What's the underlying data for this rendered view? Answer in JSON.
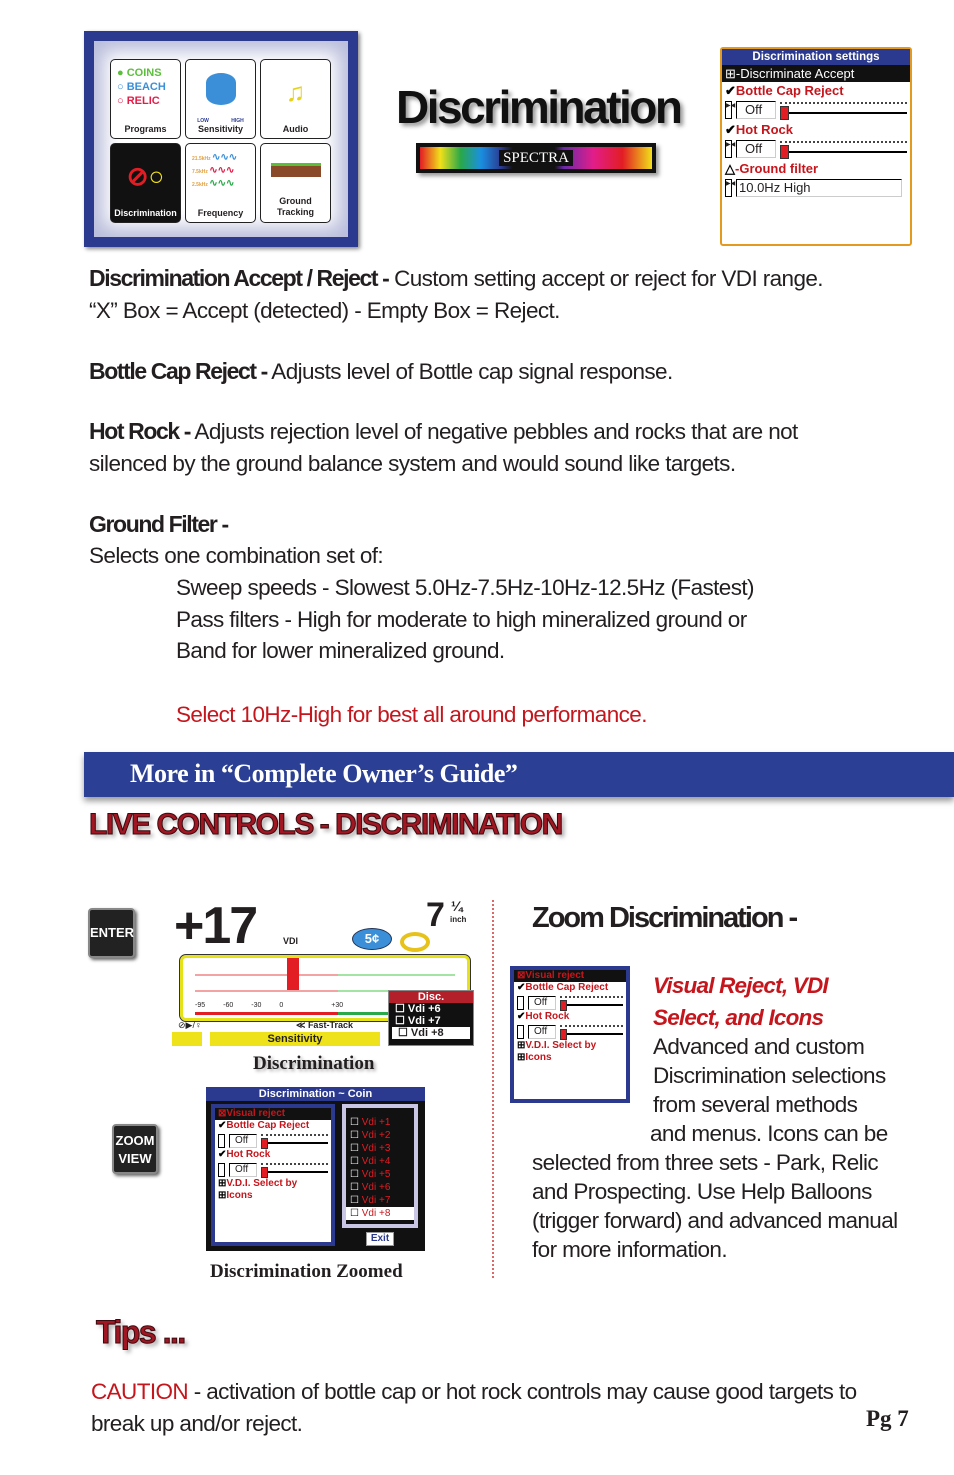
{
  "menu": {
    "programs": {
      "options": [
        "COINS",
        "BEACH",
        "RELIC"
      ],
      "label": "Programs"
    },
    "tiles": [
      "Sensitivity",
      "Audio",
      "Discrimination",
      "Frequency",
      "Ground Tracking"
    ],
    "sensitivity_scale": [
      "LOW",
      "HIGH"
    ],
    "frequencies": [
      "21.5kHz",
      "7.5kHz",
      "2.5kHz"
    ]
  },
  "page_title": "Discrimination",
  "logo_text": "SPECTRA",
  "settings_panel": {
    "title": "Discrimination settings",
    "discriminate": "Discriminate Accept",
    "bottle_cap": "Bottle Cap Reject",
    "bottle_cap_value": "Off",
    "hot_rock": "Hot Rock",
    "hot_rock_value": "Off",
    "ground_filter": "Ground filter",
    "ground_filter_value": "10.0Hz High",
    "bottle_cap_level": 0,
    "hot_rock_level": 0
  },
  "sections": {
    "disc_head": "Discrimination Accept / Reject -",
    "disc_text": " Custom setting accept or reject for VDI range.",
    "disc_text2": "“X”  Box = Accept (detected)  -  Empty Box = Reject.",
    "bottle_head": "Bottle Cap Reject -",
    "bottle_text": " Adjusts level of Bottle cap signal response.",
    "hot_head": "Hot Rock -",
    "hot_text": " Adjusts rejection level of negative pebbles and rocks that are not",
    "hot_text2": "silenced by the ground balance system and would sound like targets.",
    "ground_head": "Ground Filter -",
    "ground_text": "Selects one combination set of:",
    "ground_l1": "Sweep speeds - Slowest 5.0Hz-7.5Hz-10Hz-12.5Hz (Fastest)",
    "ground_l2": "Pass filters - High for moderate to high mineralized ground or",
    "ground_l3": "Band for lower mineralized ground.",
    "recommend": "Select 10Hz-High for best all around performance."
  },
  "banner": "More in “Complete Owner’s Guide”",
  "live_title": "LIVE CONTROLS - DISCRIMINATION",
  "keys": {
    "enter": "ENTER",
    "zoom": "ZOOM",
    "view": "VIEW"
  },
  "live_screen": {
    "vdi": "+17",
    "vdi_label": "VDI",
    "depth": "7",
    "depth_frac": "¼",
    "depth_unit": "inch",
    "coin": "5¢",
    "scale": [
      "-95",
      "-60",
      "-30",
      "0",
      "+30"
    ],
    "fast_track": "Fast-Track",
    "sensitivity": "Sensitivity",
    "disc_label": "Disc.",
    "disc_items": [
      "Vdi +6",
      "Vdi +7",
      "Vdi +8"
    ],
    "caption": "Discrimination"
  },
  "zoomed_screen": {
    "title": "Discrimination ~ Coin",
    "items": [
      "Visual reject",
      "Bottle Cap Reject",
      "Off",
      "Hot Rock",
      "Off",
      "V.D.I. Select by",
      "Icons"
    ],
    "vdi_list": [
      "Vdi +1",
      "Vdi +2",
      "Vdi +3",
      "Vdi +4",
      "Vdi +5",
      "Vdi +6",
      "Vdi +7",
      "Vdi +8"
    ],
    "exit": "Exit",
    "caption": "Discrimination Zoomed"
  },
  "zoom_section": {
    "head": "Zoom Discrimination -",
    "red1": "Visual Reject, VDI",
    "red2": "Select, and Icons",
    "lines": [
      "Advanced and custom",
      "Discrimination selections",
      "from several methods",
      "and menus.  Icons can be",
      "selected from three sets - Park, Relic",
      "and Prospecting.  Use Help Balloons",
      "(trigger forward) and advanced manual",
      "for more information."
    ]
  },
  "tips": {
    "title": "Tips ...",
    "caution": "CAUTION",
    "text": " - activation of bottle cap or hot rock controls may cause good targets to",
    "text2": "break up and/or reject."
  },
  "page_number": "Pg 7",
  "colors": {
    "accent_blue": "#2b3f94",
    "accent_red": "#c4161c",
    "panel_orange": "#e39a1f"
  }
}
